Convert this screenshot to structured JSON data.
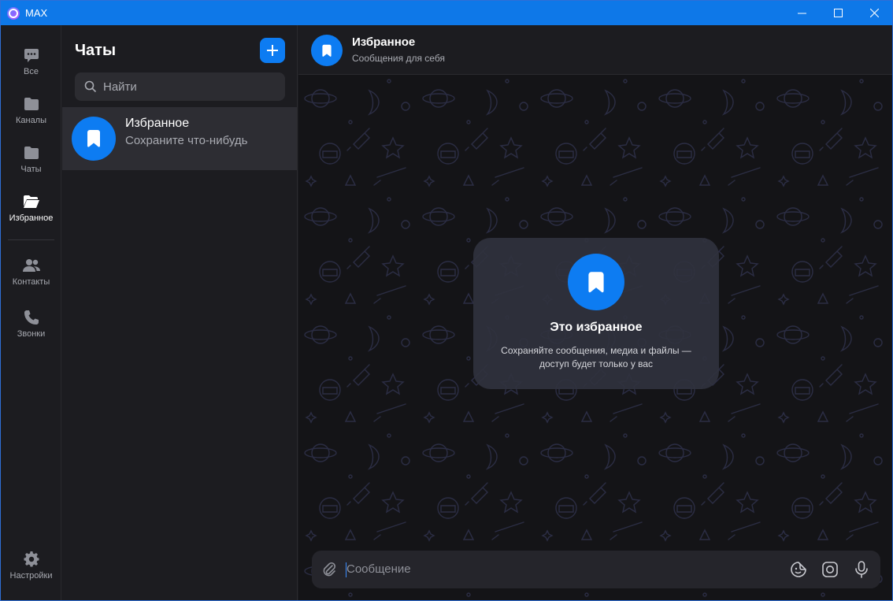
{
  "window": {
    "app_title": "MAX"
  },
  "rail": {
    "items": [
      {
        "label": "Все",
        "icon": "chat-bubble-icon"
      },
      {
        "label": "Каналы",
        "icon": "folder-icon"
      },
      {
        "label": "Чаты",
        "icon": "folder-icon"
      },
      {
        "label": "Избранное",
        "icon": "folder-open-icon",
        "active": true
      },
      {
        "label": "Контакты",
        "icon": "contacts-icon"
      },
      {
        "label": "Звонки",
        "icon": "phone-icon"
      }
    ],
    "settings_label": "Настройки"
  },
  "chat_list": {
    "title": "Чаты",
    "search_placeholder": "Найти",
    "chats": [
      {
        "name": "Избранное",
        "preview": "Сохраните что-нибудь",
        "icon": "bookmark-icon"
      }
    ]
  },
  "conversation": {
    "title": "Избранное",
    "subtitle": "Сообщения для себя",
    "empty_state": {
      "title": "Это избранное",
      "text": "Сохраняйте сообщения, медиа и файлы — доступ будет только у вас"
    },
    "composer_placeholder": "Сообщение"
  },
  "colors": {
    "accent": "#0d7cf2",
    "titlebar": "#0e78e8",
    "background": "#141417",
    "panel": "#1c1c20"
  }
}
